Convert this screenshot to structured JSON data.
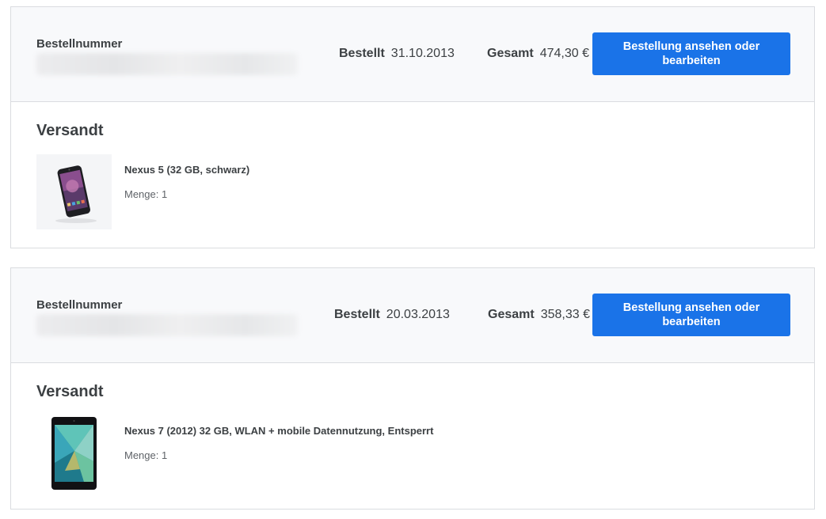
{
  "orders": [
    {
      "order_number_label": "Bestellnummer",
      "ordered_label": "Bestellt",
      "ordered_date": "31.10.2013",
      "total_label": "Gesamt",
      "total_value": "474,30 €",
      "view_button": "Bestellung ansehen oder bearbeiten",
      "status": "Versandt",
      "product_image": "nexus-5-phone-image",
      "product_name": "Nexus 5 (32 GB, schwarz)",
      "quantity": "Menge: 1"
    },
    {
      "order_number_label": "Bestellnummer",
      "ordered_label": "Bestellt",
      "ordered_date": "20.03.2013",
      "total_label": "Gesamt",
      "total_value": "358,33 €",
      "view_button": "Bestellung ansehen oder bearbeiten",
      "status": "Versandt",
      "product_image": "nexus-7-tablet-image",
      "product_name": "Nexus 7 (2012) 32 GB, WLAN + mobile Datennutzung, Entsperrt",
      "quantity": "Menge: 1"
    }
  ]
}
